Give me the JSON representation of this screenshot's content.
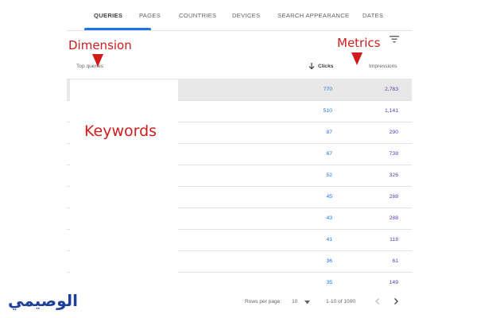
{
  "tabs": [
    {
      "label": "QUERIES",
      "active": true
    },
    {
      "label": "PAGES",
      "active": false
    },
    {
      "label": "COUNTRIES",
      "active": false
    },
    {
      "label": "DEVICES",
      "active": false
    },
    {
      "label": "SEARCH APPEARANCE",
      "active": false
    },
    {
      "label": "DATES",
      "active": false
    }
  ],
  "table": {
    "headers": {
      "dimension": "Top queries",
      "clicks": "Clicks",
      "impressions": "Impressions"
    },
    "rows": [
      {
        "clicks": "770",
        "impressions": "2,783"
      },
      {
        "clicks": "510",
        "impressions": "1,141"
      },
      {
        "clicks": "87",
        "impressions": "290"
      },
      {
        "clicks": "67",
        "impressions": "738"
      },
      {
        "clicks": "52",
        "impressions": "326"
      },
      {
        "clicks": "45",
        "impressions": "288"
      },
      {
        "clicks": "43",
        "impressions": "288"
      },
      {
        "clicks": "41",
        "impressions": "118"
      },
      {
        "clicks": "36",
        "impressions": "61"
      },
      {
        "clicks": "35",
        "impressions": "149"
      }
    ]
  },
  "footer": {
    "rows_per_page_label": "Rows per page:",
    "rows_per_page_value": "10",
    "range": "1-10 of 1000"
  },
  "annotations": {
    "dimension": "Dimension",
    "metrics": "Metrics",
    "keywords": "Keywords"
  },
  "logo": {
    "text": "الوصيمي"
  },
  "colors": {
    "accent": "#1a73e8",
    "clicks": "#1a73e8",
    "impressions": "#5e35b1",
    "annotation": "#d21c1c",
    "logo": "#1c3f9b"
  },
  "icons": {
    "filter": "filter-icon",
    "sort": "arrow-down-icon",
    "dropdown": "caret-down-icon",
    "prev": "chevron-left-icon",
    "next": "chevron-right-icon"
  }
}
